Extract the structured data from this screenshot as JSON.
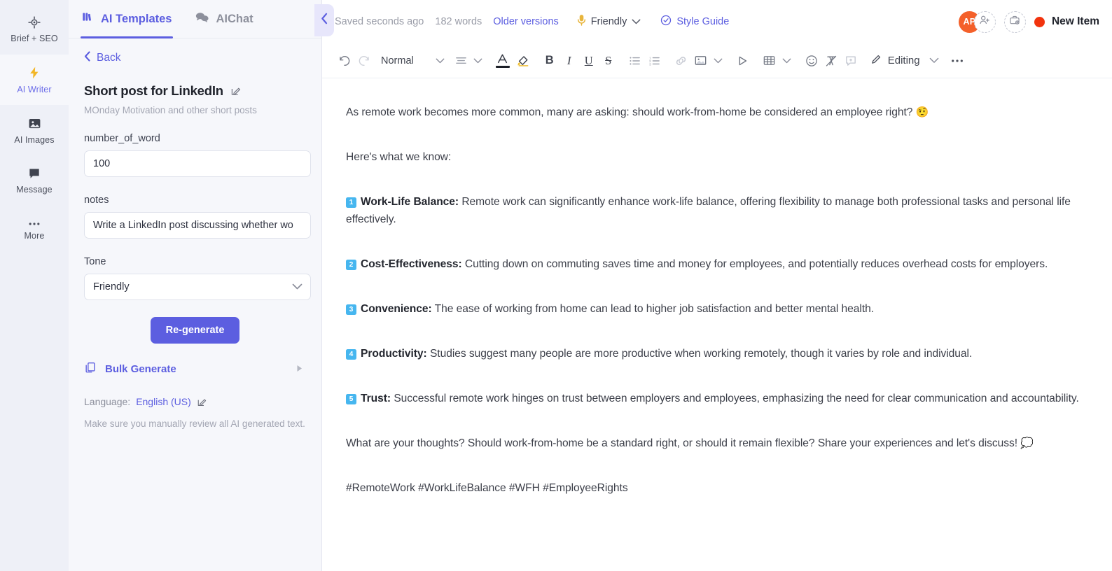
{
  "rail": {
    "items": [
      {
        "label": "Brief + SEO",
        "icon": "target-icon",
        "active": false
      },
      {
        "label": "AI Writer",
        "icon": "lightning-bolt-icon",
        "active": true
      },
      {
        "label": "AI Images",
        "icon": "image-icon",
        "active": false
      },
      {
        "label": "Message",
        "icon": "chat-bubble-icon",
        "active": false
      },
      {
        "label": "More",
        "icon": "ellipsis-icon",
        "active": false
      }
    ]
  },
  "panel": {
    "tabs": [
      {
        "label": "AI Templates",
        "icon": "templates-grid-icon",
        "active": true
      },
      {
        "label": "AIChat",
        "icon": "chat-bubbles-icon",
        "active": false
      }
    ],
    "back_label": "Back",
    "template_title": "Short post for LinkedIn",
    "template_subtitle": "MOnday Motivation and other short posts",
    "fields": [
      {
        "label": "number_of_word",
        "value": "100",
        "type": "text"
      },
      {
        "label": "notes",
        "value": "Write a LinkedIn post discussing whether wo",
        "type": "text"
      },
      {
        "label": "Tone",
        "value": "Friendly",
        "type": "select"
      }
    ],
    "regenerate_label": "Re-generate",
    "bulk_generate_label": "Bulk Generate",
    "language_prefix": "Language:",
    "language_value": "English (US)",
    "disclaimer": "Make sure you manually review all AI generated text.",
    "collapse_icon": "chevron-left-icon"
  },
  "editor": {
    "topbar": {
      "saved_status": "Saved seconds ago",
      "word_count": "182 words",
      "older_versions": "Older versions",
      "tone": "Friendly",
      "style_guide": "Style Guide",
      "avatar_initials": "AP",
      "new_item_label": "New Item"
    },
    "toolbar": {
      "undo": "undo-icon",
      "redo": "redo-icon",
      "style_label": "Normal",
      "align": "align-left-icon",
      "text_color": "text-color-icon",
      "highlight": "highlighter-icon",
      "bold": "B",
      "italic": "I",
      "underline": "U",
      "strikethrough": "S",
      "bullet_list": "bullet-list-icon",
      "numbered_list": "numbered-list-icon",
      "link": "link-icon",
      "image": "image-icon",
      "video": "play-video-icon",
      "table": "table-icon",
      "emoji": "emoji-icon",
      "clear_format": "clear-format-icon",
      "comment": "add-comment-icon",
      "mode_label": "Editing",
      "more": "more-options-icon"
    },
    "document": {
      "paragraphs": [
        {
          "type": "plain",
          "text": "As remote work becomes more common, many are asking: should work-from-home be considered an employee right? ",
          "emoji": "🤨"
        },
        {
          "type": "plain",
          "text": "Here's what we know:",
          "emoji": ""
        },
        {
          "type": "numbered",
          "number": "1",
          "heading": "Work-Life Balance:",
          "text": " Remote work can significantly enhance work-life balance, offering flexibility to manage both professional tasks and personal life effectively."
        },
        {
          "type": "numbered",
          "number": "2",
          "heading": "Cost-Effectiveness:",
          "text": " Cutting down on commuting saves time and money for employees, and potentially reduces overhead costs for employers."
        },
        {
          "type": "numbered",
          "number": "3",
          "heading": "Convenience:",
          "text": " The ease of working from home can lead to higher job satisfaction and better mental health."
        },
        {
          "type": "numbered",
          "number": "4",
          "heading": "Productivity:",
          "text": " Studies suggest many people are more productive when working remotely, though it varies by role and individual."
        },
        {
          "type": "numbered",
          "number": "5",
          "heading": "Trust:",
          "text": " Successful remote work hinges on trust between employers and employees, emphasizing the need for clear communication and accountability."
        },
        {
          "type": "plain",
          "text": "What are your thoughts? Should work-from-home be a standard right, or should it remain flexible? Share your experiences and let's discuss! ",
          "emoji": "💭"
        },
        {
          "type": "plain",
          "text": "#RemoteWork #WorkLifeBalance #WFH #EmployeeRights",
          "emoji": ""
        }
      ]
    }
  },
  "colors": {
    "accent_purple": "#5c5ee0",
    "rail_bg": "#eef0f7",
    "panel_bg": "#f6f7fb",
    "avatar_orange": "#f4602a",
    "status_dot_red": "#f2330d",
    "badge_blue": "#46b6ef",
    "bolt_yellow": "#f2b627"
  }
}
